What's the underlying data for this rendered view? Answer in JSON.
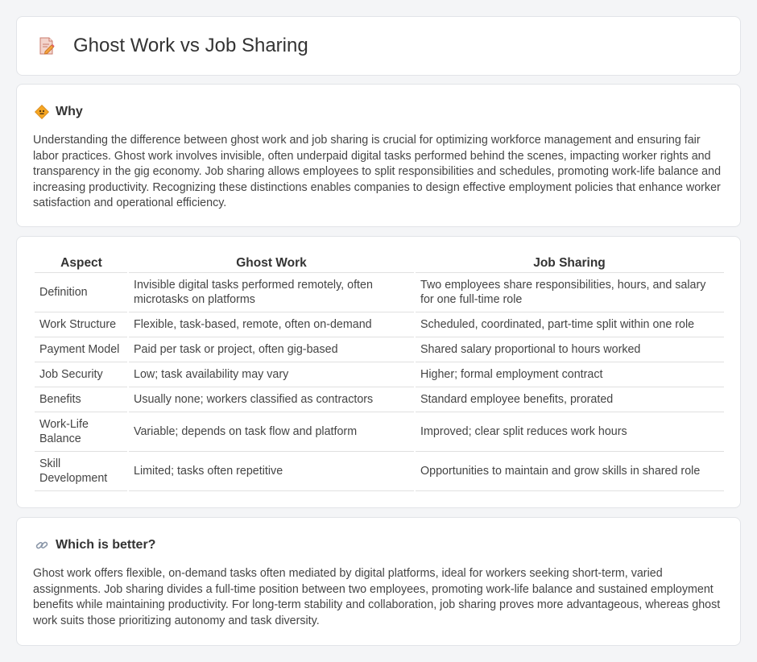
{
  "page": {
    "title": "Ghost Work vs Job Sharing",
    "title_icon": "document-pencil-icon"
  },
  "why": {
    "heading": "Why",
    "icon": "diamond-sign-icon",
    "body": "Understanding the difference between ghost work and job sharing is crucial for optimizing workforce management and ensuring fair labor practices. Ghost work involves invisible, often underpaid digital tasks performed behind the scenes, impacting worker rights and transparency in the gig economy. Job sharing allows employees to split responsibilities and schedules, promoting work-life balance and increasing productivity. Recognizing these distinctions enables companies to design effective employment policies that enhance worker satisfaction and operational efficiency."
  },
  "table": {
    "headers": [
      "Aspect",
      "Ghost Work",
      "Job Sharing"
    ],
    "rows": [
      [
        "Definition",
        "Invisible digital tasks performed remotely, often microtasks on platforms",
        "Two employees share responsibilities, hours, and salary for one full-time role"
      ],
      [
        "Work Structure",
        "Flexible, task-based, remote, often on-demand",
        "Scheduled, coordinated, part-time split within one role"
      ],
      [
        "Payment Model",
        "Paid per task or project, often gig-based",
        "Shared salary proportional to hours worked"
      ],
      [
        "Job Security",
        "Low; task availability may vary",
        "Higher; formal employment contract"
      ],
      [
        "Benefits",
        "Usually none; workers classified as contractors",
        "Standard employee benefits, prorated"
      ],
      [
        "Work-Life Balance",
        "Variable; depends on task flow and platform",
        "Improved; clear split reduces work hours"
      ],
      [
        "Skill Development",
        "Limited; tasks often repetitive",
        "Opportunities to maintain and grow skills in shared role"
      ]
    ]
  },
  "better": {
    "heading": "Which is better?",
    "icon": "link-icon",
    "body": "Ghost work offers flexible, on-demand tasks often mediated by digital platforms, ideal for workers seeking short-term, varied assignments. Job sharing divides a full-time position between two employees, promoting work-life balance and sustained employment benefits while maintaining productivity. For long-term stability and collaboration, job sharing proves more advantageous, whereas ghost work suits those prioritizing autonomy and task diversity."
  }
}
